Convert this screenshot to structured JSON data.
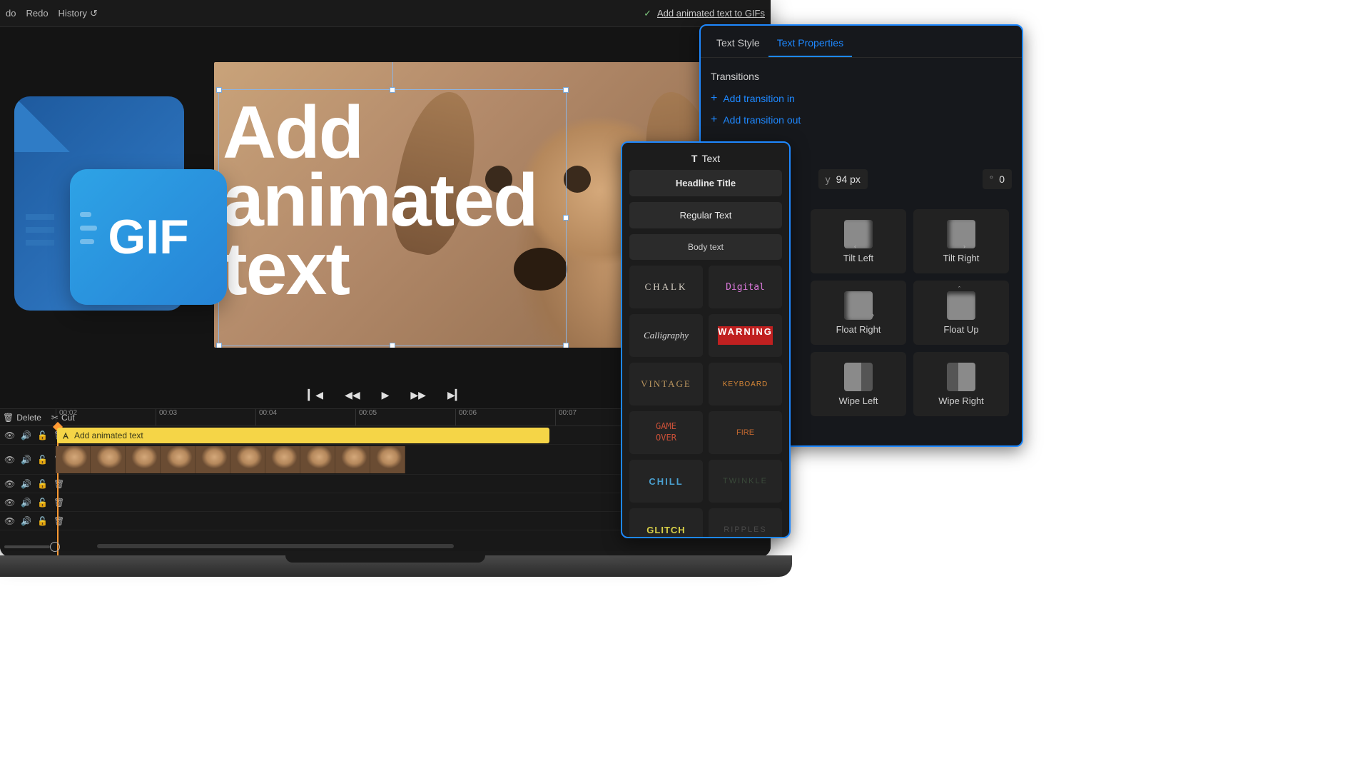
{
  "topbar": {
    "undo": "do",
    "redo": "Redo",
    "history": "History",
    "status_label": "Add animated text to GIFs"
  },
  "canvas": {
    "overlay_text": "Add\nanimated\ntext"
  },
  "gif_badge": {
    "label": "GIF"
  },
  "playback": {},
  "timeline_tools": {
    "delete": "Delete",
    "cut": "Cut"
  },
  "ruler": {
    "ticks": [
      "00:02",
      "00:03",
      "00:04",
      "00:05",
      "00:06",
      "00:07"
    ]
  },
  "tracks": {
    "text_clip_label": "Add animated text"
  },
  "text_panel": {
    "title": "Text",
    "buttons": {
      "headline": "Headline Title",
      "regular": "Regular Text",
      "body": "Body text"
    },
    "styles": {
      "chalk": "CHALK",
      "digital": "Digital",
      "calligraphy": "Calligraphy",
      "warning": "WARNING",
      "vintage": "VINTAGE",
      "keyboard": "KEYBOARD",
      "gameover": "GAME\nOVER",
      "fire": "FIRE",
      "chill": "CHILL",
      "twinkle": "TWINKLE",
      "glitch": "GLITCH",
      "ripples": "RIPPLES"
    }
  },
  "props": {
    "tabs": {
      "style": "Text Style",
      "properties": "Text Properties"
    },
    "transitions_title": "Transitions",
    "add_in": "Add transition in",
    "add_out": "Add transition out",
    "y_label": "y",
    "y_value": "94 px",
    "deg_label": "°",
    "deg_value": "0",
    "anims": {
      "tilt_left": "Tilt Left",
      "tilt_right": "Tilt Right",
      "float_right": "Float Right",
      "float_up": "Float Up",
      "wipe_left": "Wipe Left",
      "wipe_right": "Wipe Right"
    }
  }
}
